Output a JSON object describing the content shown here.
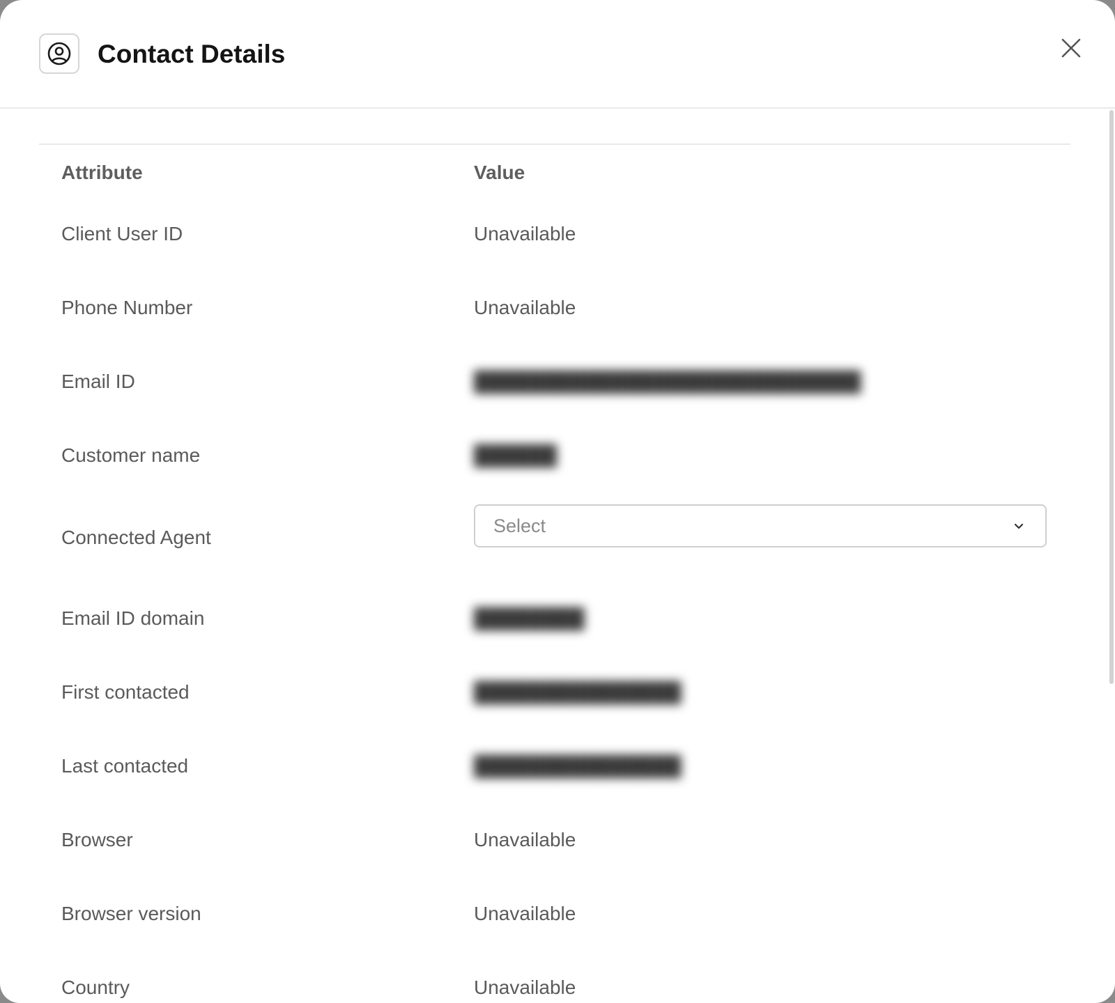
{
  "modal": {
    "title": "Contact Details",
    "icon": "user-circle-icon",
    "close_icon": "close-icon"
  },
  "table": {
    "headers": {
      "attribute": "Attribute",
      "value": "Value"
    },
    "rows": [
      {
        "attribute": "Client User ID",
        "value": "Unavailable",
        "type": "text"
      },
      {
        "attribute": "Phone Number",
        "value": "Unavailable",
        "type": "text"
      },
      {
        "attribute": "Email ID",
        "value": "",
        "type": "redacted"
      },
      {
        "attribute": "Customer name",
        "value": "",
        "type": "redacted"
      },
      {
        "attribute": "Connected Agent",
        "value": "",
        "type": "select",
        "placeholder": "Select"
      },
      {
        "attribute": "Email ID domain",
        "value": "",
        "type": "redacted"
      },
      {
        "attribute": "First contacted",
        "value": "",
        "type": "redacted"
      },
      {
        "attribute": "Last contacted",
        "value": "",
        "type": "redacted"
      },
      {
        "attribute": "Browser",
        "value": "Unavailable",
        "type": "text"
      },
      {
        "attribute": "Browser version",
        "value": "Unavailable",
        "type": "text"
      },
      {
        "attribute": "Country",
        "value": "Unavailable",
        "type": "text"
      }
    ]
  }
}
